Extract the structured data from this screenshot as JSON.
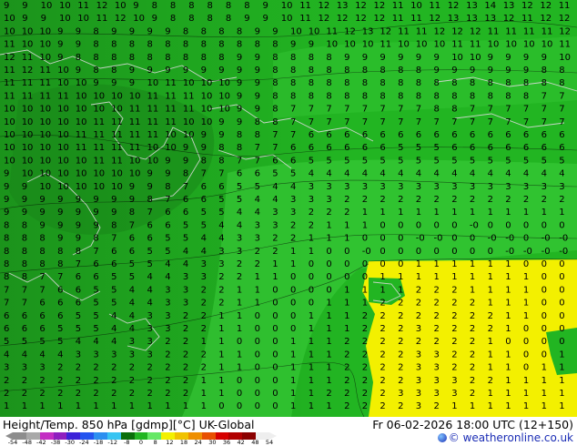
{
  "footer": {
    "title": "Height/Temp. 850 hPa [gdmp][°C] UK-Global",
    "datetime": "Fr 06-02-2026 18:00 UTC (12+150)",
    "credit": "© weatheronline.co.uk"
  },
  "legend": {
    "ticks": [
      "-54",
      "-48",
      "-42",
      "-38",
      "-30",
      "-24",
      "-18",
      "-12",
      "-8",
      "0",
      "8",
      "12",
      "18",
      "24",
      "30",
      "36",
      "42",
      "48",
      "54"
    ],
    "colors": [
      "#8d8d8d",
      "#a9a9a9",
      "#c32ec3",
      "#8f1fbf",
      "#3c22d8",
      "#2454ef",
      "#2c8ff0",
      "#38c4f2",
      "#0a6e0a",
      "#22b522",
      "#66e866",
      "#f3f000",
      "#f0c200",
      "#ee8f00",
      "#e84f00",
      "#d60000",
      "#b10000",
      "#8b0000",
      "#eeeeee"
    ]
  },
  "map": {
    "colors": {
      "dark_green": "#1e9a1e",
      "green": "#22b522",
      "light_green": "#39d039",
      "yellow": "#f3f000",
      "contour": "#000000",
      "coast": "#d8d8d8"
    },
    "label_rows": [
      "9 9 10 10 11 12 10 9 8 8 8 8 8 8 9 10 11 12 13 12 12 11 10 11 12 13 14 13 12 12 11",
      "10 9 9 10 10 11 12 10 9 8 8 8 8 9 9 10 11 12 12 12 12 11 11 12 13 13 13 12 11 12 12",
      "10 10 10 9 9 8 9 9 9 9 8 8 8 8 9 9 10 10 11 12 13 12 11 11 12 12 12 11 11 11 11 12",
      "11 10 10 9 9 8 8 8 8 8 8 8 8 8 8 8 9 9 10 10 10 11 10 10 10 11 11 10 10 10 10 11",
      "12 11 10 9 8 8 8 8 8 8 8 8 8 9 9 8 8 8 8 9 9 9 9 9 9 10 10 9 9 9 9 10",
      "11 12 11 10 9 8 8 9 9 9 9 9 9 9 9 8 8 8 8 8 8 8 8 8 9 9 9 9 9 9 8 8",
      "11 11 11 10 10 9 9 9 10 11 10 10 10 9 9 8 8 8 8 8 8 8 8 8 8 8 8 8 8 8 8 8",
      "11 11 11 11 10 10 10 10 11 11 11 10 10 9 9 8 8 8 8 8 8 8 8 8 8 8 8 8 8 8 7 7",
      "10 10 10 10 10 10 10 11 11 11 11 10 10 9 9 8 7 7 7 7 7 7 7 7 8 8 7 7 7 7 7 7",
      "10 10 10 10 10 11 11 11 11 11 10 10 9 9 8 8 7 7 7 7 7 7 7 7 7 7 7 7 7 7 7 7",
      "10 10 10 10 11 11 11 11 11 10 10 9 9 8 8 7 7 6 6 6 6 6 6 6 6 6 6 6 6 6 6 6",
      "10 10 10 10 11 11 11 11 10 10 9 9 8 8 7 7 6 6 6 6 6 6 5 5 5 6 6 6 6 6 6 6",
      "10 10 10 10 10 11 11 10 10 9 9 8 8 7 7 6 6 5 5 5 5 5 5 5 5 5 5 5 5 5 5 5",
      "9 10 10 10 10 10 10 10 9 9 8 7 7 6 6 5 5 4 4 4 4 4 4 4 4 4 4 4 4 4 4 4",
      "9 9 10 10 10 10 10 9 9 8 7 6 6 5 5 4 4 3 3 3 3 3 3 3 3 3 3 3 3 3 3 3",
      "9 9 9 9 9 9 9 9 8 7 6 6 5 5 4 4 3 3 3 2 2 2 2 2 2 2 2 2 2 2 2 2",
      "9 9 9 9 9 9 9 8 7 6 6 5 5 4 4 3 3 2 2 2 1 1 1 1 1 1 1 1 1 1 1 1",
      "8 8 9 9 9 9 8 7 6 6 5 5 4 4 3 3 2 2 1 1 1 0 0 0 0 0 -0 0 0 0 0 0",
      "8 8 8 9 9 8 7 6 6 5 5 4 4 3 3 2 2 1 1 1 0 0 0 -0 -0 0 0 -0 -0 0 -0 -0",
      "8 8 8 8 8 7 6 6 5 5 4 4 3 3 2 2 1 1 0 0 -0 0 0 0 0 0 0 0 -0 -0 -0 -0",
      "8 8 8 8 7 6 6 5 5 4 4 3 3 2 2 1 1 0 0 0 0 0 0 1 1 1 1 1 1 0 0 0",
      "8 8 7 7 6 6 5 5 4 4 3 3 2 2 1 1 0 0 0 0 0 1 1 1 1 1 1 1 1 1 0 0",
      "7 7 7 6 6 5 5 4 4 3 3 2 2 1 1 0 0 0 0 1 1 1 1 2 2 2 1 1 1 1 0 0",
      "7 7 6 6 6 5 5 4 4 3 3 2 2 1 1 0 0 0 1 1 1 2 2 2 2 2 2 1 1 1 0 0",
      "6 6 6 6 5 5 4 4 3 3 2 2 1 1 0 0 0 1 1 1 2 2 2 2 2 2 2 2 1 1 0 0",
      "6 6 6 5 5 5 4 4 3 3 2 2 1 1 0 0 0 1 1 1 2 2 2 3 2 2 2 2 1 0 0 0",
      "5 5 5 5 4 4 4 3 3 2 2 1 1 0 0 0 1 1 1 2 2 2 2 2 2 2 2 1 0 0 0 0",
      "4 4 4 4 3 3 3 3 3 2 2 2 1 1 0 0 1 1 1 2 2 2 2 3 3 2 2 1 1 0 0 1",
      "3 3 3 2 2 2 2 2 2 2 2 2 1 1 0 0 1 1 1 2 2 2 2 3 3 2 2 1 1 0 1 1",
      "2 2 2 2 2 2 2 2 2 2 2 1 1 0 0 0 1 1 1 2 2 2 2 3 3 3 2 2 1 1 1 1",
      "2 2 2 2 2 2 2 2 2 2 2 1 1 0 0 0 1 1 2 2 2 2 3 3 3 3 2 1 1 1 1 1",
      "1 1 1 1 1 1 1 1 1 1 1 1 0 0 0 0 1 1 1 2 2 2 2 3 2 1 1 1 1 1 1 1"
    ]
  }
}
